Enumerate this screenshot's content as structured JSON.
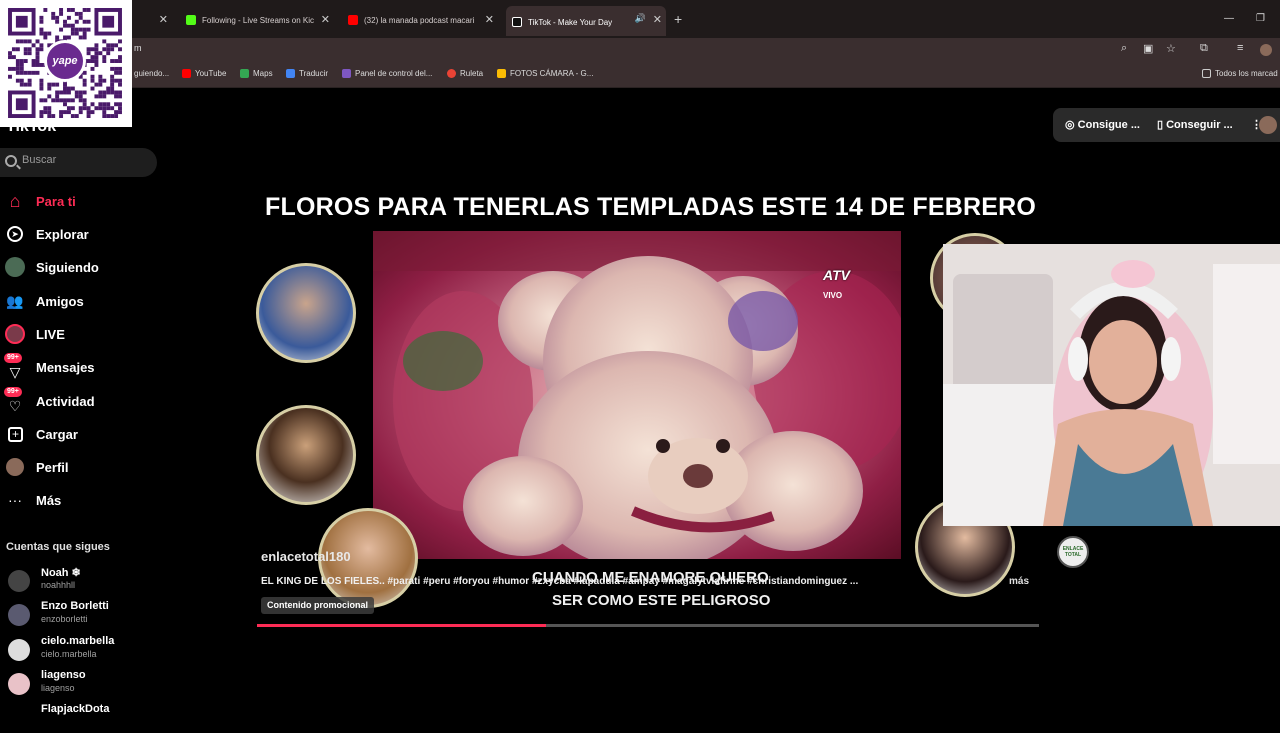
{
  "browser": {
    "tabs": [
      {
        "title": "",
        "color": "#888888",
        "active": false
      },
      {
        "title": "Following - Live Streams on Kic",
        "color": "#53fc18",
        "active": false
      },
      {
        "title": "(32) la manada podcast macari",
        "color": "#ff0000",
        "active": false
      },
      {
        "title": "TikTok - Make Your Day",
        "color": "#111111",
        "active": true
      }
    ],
    "address_fragment": "m",
    "bookmarks": [
      {
        "label": "guiendo...",
        "color": "#888888"
      },
      {
        "label": "YouTube",
        "color": "#ff0000"
      },
      {
        "label": "Maps",
        "color": "#34a853"
      },
      {
        "label": "Traducir",
        "color": "#4285f4"
      },
      {
        "label": "Panel de control del...",
        "color": "#7e57c2"
      },
      {
        "label": "Ruleta",
        "color": "#ea4335"
      },
      {
        "label": "FOTOS CÁMARA - G...",
        "color": "#fbbc04"
      }
    ],
    "all_bookmarks": "Todos los marcad"
  },
  "overlay": {
    "qr_brand": "yape"
  },
  "sidebar": {
    "logo_peek": "TikTok",
    "search_placeholder": "Buscar",
    "nav": [
      {
        "label": "Para ti",
        "icon": "home-icon",
        "active": true,
        "badge": ""
      },
      {
        "label": "Explorar",
        "icon": "compass-icon",
        "active": false,
        "badge": ""
      },
      {
        "label": "Siguiendo",
        "icon": "following-avatar-icon",
        "active": false,
        "badge": ""
      },
      {
        "label": "Amigos",
        "icon": "friends-icon",
        "active": false,
        "badge": ""
      },
      {
        "label": "LIVE",
        "icon": "live-icon",
        "active": false,
        "badge": ""
      },
      {
        "label": "Mensajes",
        "icon": "messages-icon",
        "active": false,
        "badge": "99+"
      },
      {
        "label": "Actividad",
        "icon": "activity-icon",
        "active": false,
        "badge": "99+"
      },
      {
        "label": "Cargar",
        "icon": "upload-icon",
        "active": false,
        "badge": ""
      },
      {
        "label": "Perfil",
        "icon": "profile-icon",
        "active": false,
        "badge": ""
      },
      {
        "label": "Más",
        "icon": "more-icon",
        "active": false,
        "badge": ""
      }
    ],
    "following_title": "Cuentas que sigues",
    "accounts": [
      {
        "name": "Noah ❄",
        "handle": "noahhhll"
      },
      {
        "name": "Enzo Borletti",
        "handle": "enzoborletti"
      },
      {
        "name": "cielo.marbella",
        "handle": "cielo.marbella"
      },
      {
        "name": "liagenso",
        "handle": "liagenso"
      },
      {
        "name": "FlapjackDota",
        "handle": ""
      }
    ]
  },
  "topbar": {
    "btn1": "Consigue ...",
    "btn2": "Conseguir ...",
    "menu": "⋮"
  },
  "video": {
    "headline": "FLOROS PARA TENERLAS TEMPLADAS ESTE 14 DE FEBRERO",
    "channel_logo": "ATV",
    "live_label": "VIVO",
    "subtitle_line1": "CUANDO ME ENAMORE QUIERO",
    "subtitle_line2": "SER COMO ESTE PELIGROSO",
    "username": "enlacetotal180",
    "description": "EL KING DE LOS FIELES.. #parati #peru #foryou #humor #zxycba #lapadula #ampay #magalytvlafirme #christiandominguez ...",
    "more": "más",
    "promo": "Contenido promocional",
    "progress": 0.37,
    "watermark": "ENLACE TOTAL"
  }
}
